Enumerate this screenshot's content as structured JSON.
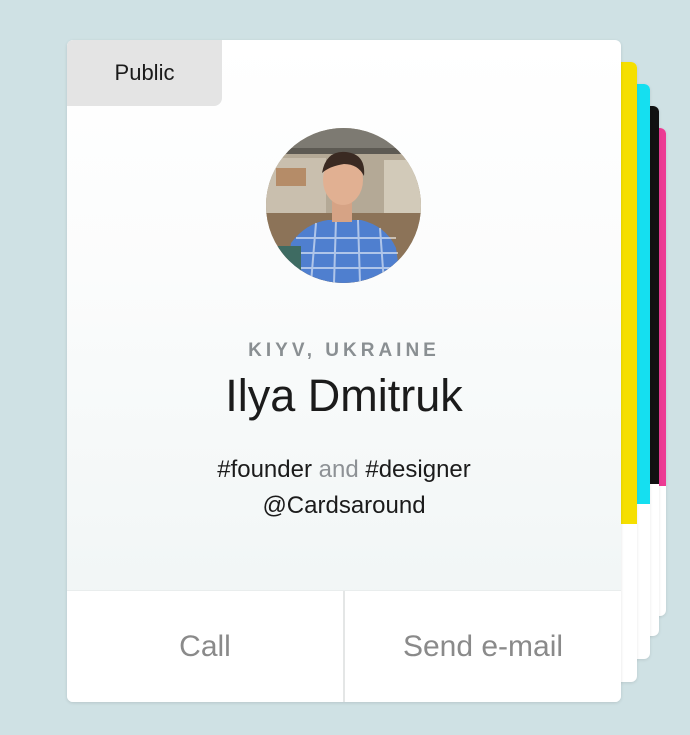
{
  "card": {
    "visibility": "Public",
    "location": "KIYV, UKRAINE",
    "name": "Ilya Dmitruk",
    "bio": {
      "tag1": "#founder",
      "connector": "and",
      "tag2": "#designer",
      "handle": "@Cardsaround"
    },
    "actions": {
      "call": "Call",
      "email": "Send e-mail"
    }
  },
  "avatar": {
    "icon": "profile-photo"
  },
  "stack_colors": [
    "#f5df00",
    "#15dff0",
    "#111111",
    "#ec3c94"
  ]
}
